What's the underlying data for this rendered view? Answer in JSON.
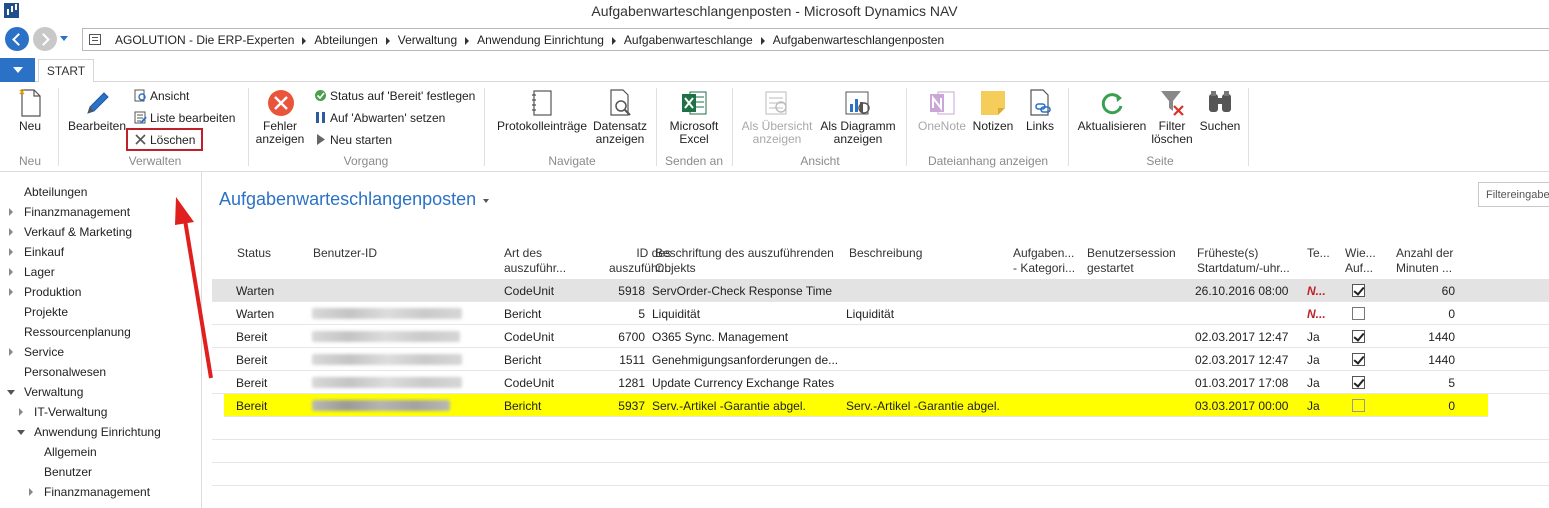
{
  "window": {
    "title": "Aufgabenwarteschlangenposten - Microsoft Dynamics NAV"
  },
  "breadcrumb": [
    "AGOLUTION - Die ERP-Experten",
    "Abteilungen",
    "Verwaltung",
    "Anwendung Einrichtung",
    "Aufgabenwarteschlange",
    "Aufgabenwarteschlangenposten"
  ],
  "tabs": {
    "start": "START"
  },
  "ribbon": {
    "neu": "Neu",
    "bearbeiten": "Bearbeiten",
    "ansicht_small": "Ansicht",
    "liste_bearbeiten": "Liste bearbeiten",
    "loeschen": "Löschen",
    "fehler_1": "Fehler",
    "fehler_2": "anzeigen",
    "status_bereit": "Status auf 'Bereit' festlegen",
    "auf_abwarten": "Auf 'Abwarten' setzen",
    "neu_starten": "Neu starten",
    "protokoll": "Protokolleinträge",
    "datensatz_1": "Datensatz",
    "datensatz_2": "anzeigen",
    "excel_1": "Microsoft",
    "excel_2": "Excel",
    "uebersicht_1": "Als Übersicht",
    "uebersicht_2": "anzeigen",
    "diagramm_1": "Als Diagramm",
    "diagramm_2": "anzeigen",
    "onenote": "OneNote",
    "notizen": "Notizen",
    "links": "Links",
    "aktualisieren": "Aktualisieren",
    "filter_1": "Filter",
    "filter_2": "löschen",
    "suchen": "Suchen",
    "groups": {
      "neu": "Neu",
      "verwalten": "Verwalten",
      "vorgang": "Vorgang",
      "navigate": "Navigate",
      "senden": "Senden an",
      "ansicht": "Ansicht",
      "dateianhang": "Dateianhang anzeigen",
      "seite": "Seite"
    }
  },
  "sidebar": {
    "items": [
      {
        "label": "Abteilungen",
        "indent": 0,
        "state": "none"
      },
      {
        "label": "Finanzmanagement",
        "indent": 0,
        "state": "closed"
      },
      {
        "label": "Verkauf & Marketing",
        "indent": 0,
        "state": "closed"
      },
      {
        "label": "Einkauf",
        "indent": 0,
        "state": "closed"
      },
      {
        "label": "Lager",
        "indent": 0,
        "state": "closed"
      },
      {
        "label": "Produktion",
        "indent": 0,
        "state": "closed"
      },
      {
        "label": "Projekte",
        "indent": 0,
        "state": "none"
      },
      {
        "label": "Ressourcenplanung",
        "indent": 0,
        "state": "none"
      },
      {
        "label": "Service",
        "indent": 0,
        "state": "closed"
      },
      {
        "label": "Personalwesen",
        "indent": 0,
        "state": "none"
      },
      {
        "label": "Verwaltung",
        "indent": 0,
        "state": "open"
      },
      {
        "label": "IT-Verwaltung",
        "indent": 1,
        "state": "closed"
      },
      {
        "label": "Anwendung Einrichtung",
        "indent": 1,
        "state": "open"
      },
      {
        "label": "Allgemein",
        "indent": 2,
        "state": "none"
      },
      {
        "label": "Benutzer",
        "indent": 2,
        "state": "none"
      },
      {
        "label": "Finanzmanagement",
        "indent": 2,
        "state": "closed"
      }
    ]
  },
  "page": {
    "title": "Aufgabenwarteschlangenposten",
    "filter_placeholder": "Filtereingabe"
  },
  "table": {
    "headers": {
      "status": "Status",
      "benutzer": "Benutzer-ID",
      "art_1": "Art des",
      "art_2": "auszuführ...",
      "id_1": "ID des",
      "id_2": "auszuführ...",
      "beschr_1": "Beschriftung des auszuführenden",
      "beschr_2": "Objekts",
      "beschreibung": "Beschreibung",
      "aufgaben_1": "Aufgaben...",
      "aufgaben_2": "- Kategori...",
      "session_1": "Benutzersession",
      "session_2": "gestartet",
      "frueh_1": "Früheste(s)",
      "frueh_2": "Startdatum/-uhr...",
      "te": "Te...",
      "wie_1": "Wie...",
      "wie_2": "Auf...",
      "anzahl_1": "Anzahl der",
      "anzahl_2": "Minuten ..."
    },
    "rows": [
      {
        "status": "Warten",
        "art": "CodeUnit",
        "id": "5918",
        "beschriftung": "ServOrder-Check Response Time",
        "beschreibung": "",
        "start": "26.10.2016 08:00",
        "te": "N...",
        "wie": true,
        "minuten": "60"
      },
      {
        "status": "Warten",
        "art": "Bericht",
        "id": "5",
        "beschriftung": "Liquidität",
        "beschreibung": "Liquidität",
        "start": "",
        "te": "N...",
        "wie": false,
        "minuten": "0"
      },
      {
        "status": "Bereit",
        "art": "CodeUnit",
        "id": "6700",
        "beschriftung": "O365 Sync. Management",
        "beschreibung": "",
        "start": "02.03.2017 12:47",
        "te": "Ja",
        "wie": true,
        "minuten": "1440"
      },
      {
        "status": "Bereit",
        "art": "Bericht",
        "id": "1511",
        "beschriftung": "Genehmigungsanforderungen de...",
        "beschreibung": "",
        "start": "02.03.2017 12:47",
        "te": "Ja",
        "wie": true,
        "minuten": "1440"
      },
      {
        "status": "Bereit",
        "art": "CodeUnit",
        "id": "1281",
        "beschriftung": "Update Currency Exchange Rates",
        "beschreibung": "",
        "start": "01.03.2017 17:08",
        "te": "Ja",
        "wie": true,
        "minuten": "5"
      },
      {
        "status": "Bereit",
        "art": "Bericht",
        "id": "5937",
        "beschriftung": "Serv.-Artikel -Garantie abgel.",
        "beschreibung": "Serv.-Artikel -Garantie abgel.",
        "start": "03.03.2017 00:00",
        "te": "Ja",
        "wie": false,
        "minuten": "0"
      }
    ]
  },
  "colors": {
    "accent": "#2b72c7",
    "highlight": "#ffff00",
    "annotation": "#e0201e"
  }
}
